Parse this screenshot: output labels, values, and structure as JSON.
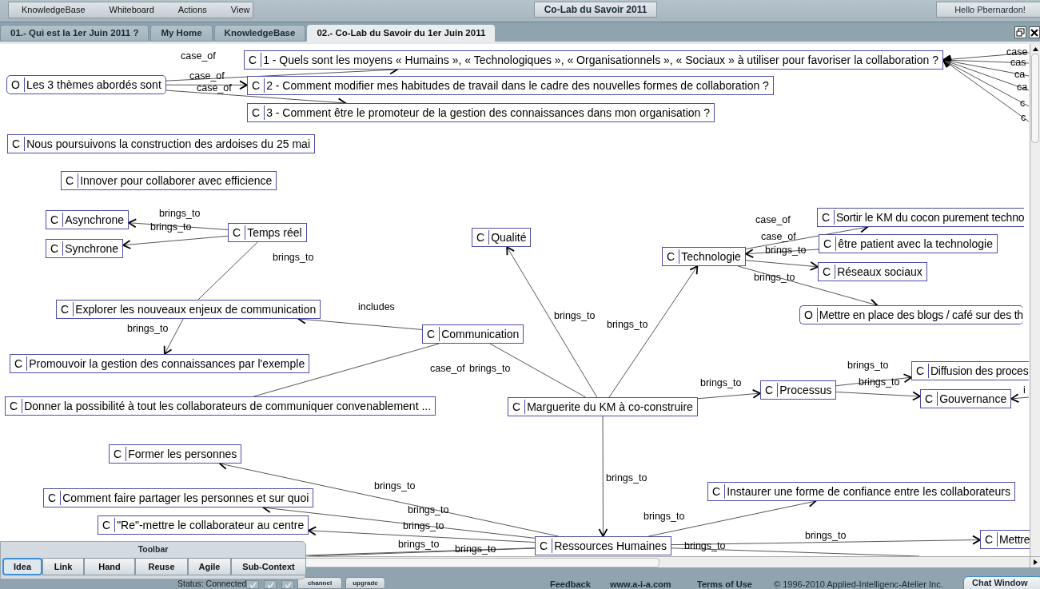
{
  "menu": [
    "KnowledgeBase",
    "Whiteboard",
    "Actions",
    "View"
  ],
  "title": "Co-Lab du Savoir 2011",
  "greeting": "Hello Pbernardon!",
  "tabs": [
    {
      "label": "01.- Qui est la 1er Juin 2011 ?",
      "selected": false
    },
    {
      "label": "My Home",
      "selected": false
    },
    {
      "label": "KnowledgeBase",
      "selected": false
    },
    {
      "label": "02.- Co-Lab du Savoir du 1er Juin 2011",
      "selected": true
    }
  ],
  "map": {
    "nodes": [
      {
        "type": "O",
        "text": "Les 3 thèmes abordés sont"
      },
      {
        "type": "C",
        "text": "1 - Quels sont les moyens « Humains », « Technologiques », « Organisationnels », « Sociaux » à utiliser pour favoriser la collaboration ?"
      },
      {
        "type": "C",
        "text": "2 - Comment modifier mes habitudes de travail dans le cadre des nouvelles formes de collaboration ?"
      },
      {
        "type": "C",
        "text": "3 - Comment être le promoteur de la gestion des connaissances dans mon organisation ?"
      },
      {
        "type": "C",
        "text": "Nous poursuivons la construction des ardoises du 25 mai"
      },
      {
        "type": "C",
        "text": "Innover pour collaborer avec efficience"
      },
      {
        "type": "C",
        "text": "Asynchrone"
      },
      {
        "type": "C",
        "text": "Synchrone"
      },
      {
        "type": "C",
        "text": "Temps réel"
      },
      {
        "type": "C",
        "text": "Qualité"
      },
      {
        "type": "C",
        "text": "Technologie"
      },
      {
        "type": "C",
        "text": "Sortir le KM du cocon purement techno"
      },
      {
        "type": "C",
        "text": "être patient avec la technologie"
      },
      {
        "type": "C",
        "text": "Réseaux sociaux"
      },
      {
        "type": "O",
        "text": "Mettre en place des blogs / café sur des th"
      },
      {
        "type": "C",
        "text": "Explorer les nouveaux enjeux de communication"
      },
      {
        "type": "C",
        "text": "Communication"
      },
      {
        "type": "C",
        "text": "Promouvoir la gestion des connaissances par l'exemple"
      },
      {
        "type": "C",
        "text": "Donner la possibilité à tout les collaborateurs de communiquer convenablement ..."
      },
      {
        "type": "C",
        "text": "Marguerite du KM à co-construire"
      },
      {
        "type": "C",
        "text": "Processus"
      },
      {
        "type": "C",
        "text": "Diffusion des proces"
      },
      {
        "type": "C",
        "text": "Gouvernance"
      },
      {
        "type": "C",
        "text": "Former les personnes"
      },
      {
        "type": "C",
        "text": "Comment faire partager les personnes et sur quoi"
      },
      {
        "type": "C",
        "text": "\"Re\"-mettre le collaborateur au centre"
      },
      {
        "type": "C",
        "text": "Ressources Humaines"
      },
      {
        "type": "C",
        "text": "Instaurer une forme de confiance entre les collaborateurs"
      },
      {
        "type": "C",
        "text": "Mettre"
      }
    ],
    "links": [
      {
        "label": "case_of",
        "directed": true
      },
      {
        "label": "case_of",
        "directed": true
      },
      {
        "label": "case_of",
        "directed": true
      },
      {
        "label": "brings_to",
        "directed": true
      },
      {
        "label": "brings_to",
        "directed": true
      },
      {
        "label": "brings_to",
        "directed": false
      },
      {
        "label": "includes",
        "directed": true
      },
      {
        "label": "brings_to",
        "directed": true
      },
      {
        "label": "case_of",
        "directed": false
      },
      {
        "label": "brings_to",
        "directed": false
      },
      {
        "label": "brings_to",
        "directed": true
      },
      {
        "label": "brings_to",
        "directed": true
      },
      {
        "label": "case_of",
        "directed": true
      },
      {
        "label": "case_of",
        "directed": true
      },
      {
        "label": "brings_to",
        "directed": true
      },
      {
        "label": "brings_to",
        "directed": true
      },
      {
        "label": "brings_to",
        "directed": true
      },
      {
        "label": "brings_to",
        "directed": true
      },
      {
        "label": "brings_to",
        "directed": true
      },
      {
        "label": "brings_to",
        "directed": true
      },
      {
        "label": "brings_to",
        "directed": true
      },
      {
        "label": "brings_to",
        "directed": true
      },
      {
        "label": "brings_to",
        "directed": true
      },
      {
        "label": "brings_to",
        "directed": true
      },
      {
        "label": "brings_to",
        "directed": true
      },
      {
        "label": "brings_to",
        "directed": false
      },
      {
        "label": "brings_to",
        "directed": false
      },
      {
        "label": "brings_to",
        "directed": false
      },
      {
        "label": "case",
        "directed": true
      },
      {
        "label": "cas",
        "directed": true
      },
      {
        "label": "ca",
        "directed": true
      },
      {
        "label": "ca",
        "directed": true
      },
      {
        "label": "c",
        "directed": true
      },
      {
        "label": "c",
        "directed": true
      },
      {
        "label": "i",
        "directed": true
      }
    ]
  },
  "toolbar": {
    "title": "Toolbar",
    "tools": [
      {
        "label": "Idea",
        "selected": true
      },
      {
        "label": "Link",
        "selected": false
      },
      {
        "label": "Hand",
        "selected": false
      },
      {
        "label": "Reuse",
        "selected": false
      },
      {
        "label": "Agile",
        "selected": false
      },
      {
        "label": "Sub-Context",
        "selected": false
      }
    ]
  },
  "status_bar": {
    "status": "Status: Connected",
    "toggles": [
      {
        "checked": true
      },
      {
        "checked": true
      },
      {
        "checked": true
      }
    ],
    "buttons": [
      "channel",
      "upgrade"
    ],
    "links": [
      "Feedback",
      "www.a-i-a.com",
      "Terms of Use"
    ],
    "copyright": "© 1996-2010 Applied-Intelligenc-Atelier Inc.",
    "chat_tab": "Chat Window"
  }
}
